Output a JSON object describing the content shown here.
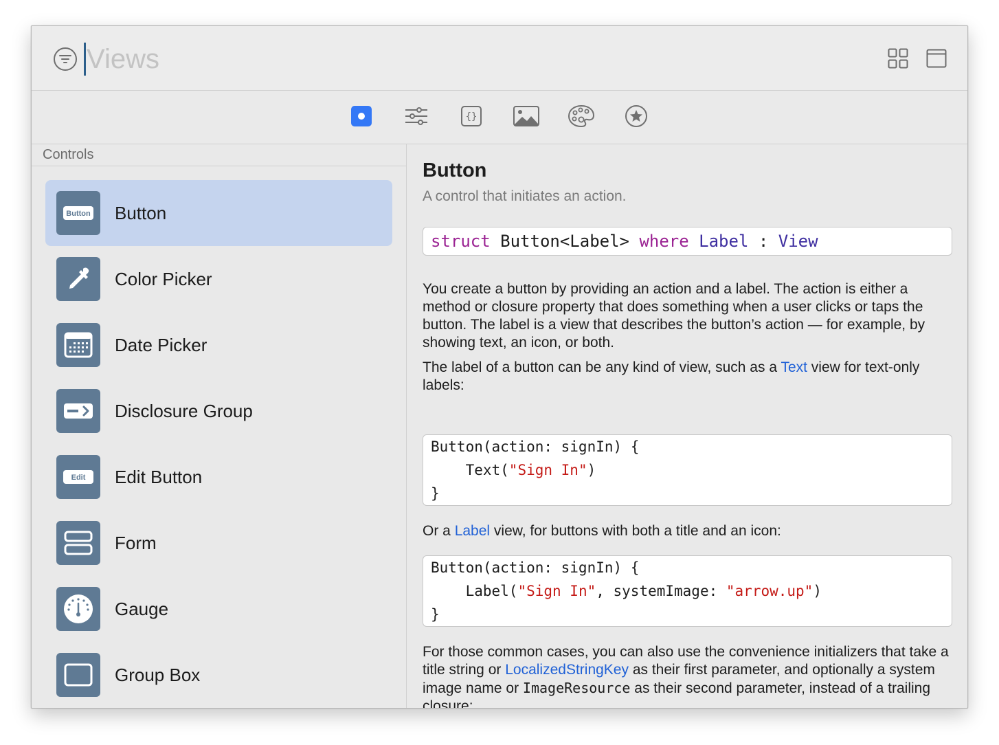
{
  "search": {
    "value": "Views"
  },
  "toolbar": {
    "tabs": [
      {
        "icon": "record-circle-icon",
        "selected": true
      },
      {
        "icon": "sliders-icon",
        "selected": false
      },
      {
        "icon": "braces-icon",
        "selected": false
      },
      {
        "icon": "photo-icon",
        "selected": false
      },
      {
        "icon": "palette-icon",
        "selected": false
      },
      {
        "icon": "star-circle-icon",
        "selected": false
      }
    ],
    "accent": "#3478f6"
  },
  "sidebar": {
    "section_title": "Controls",
    "items": [
      {
        "label": "Button",
        "icon": "button-icon",
        "icon_text": "Button",
        "selected": true
      },
      {
        "label": "Color Picker",
        "icon": "eyedropper-icon"
      },
      {
        "label": "Date Picker",
        "icon": "calendar-icon"
      },
      {
        "label": "Disclosure Group",
        "icon": "disclosure-icon"
      },
      {
        "label": "Edit Button",
        "icon": "edit-button-icon",
        "icon_text": "Edit"
      },
      {
        "label": "Form",
        "icon": "form-icon"
      },
      {
        "label": "Gauge",
        "icon": "gauge-icon"
      },
      {
        "label": "Group Box",
        "icon": "group-box-icon"
      }
    ]
  },
  "detail": {
    "title": "Button",
    "subtitle": "A control that initiates an action.",
    "declaration": {
      "kw_struct": "struct",
      "name": "Button<Label>",
      "kw_where": "where",
      "type_label": "Label",
      "colon": ":",
      "type_view": "View"
    },
    "para1": "You create a button by providing an action and a label. The action is either a method or closure property that does something when a user clicks or taps the button. The label is a view that describes the button’s action — for example, by showing text, an icon, or both.",
    "para2_pre": "The label of a button can be any kind of view, such as a ",
    "para2_link": "Text",
    "para2_post": " view for text-only labels:",
    "code1": {
      "line1": "Button(action: signIn) {",
      "line2_pre": "    Text(",
      "line2_str": "\"Sign In\"",
      "line2_post": ")",
      "line3": "}"
    },
    "para3_pre": "Or a ",
    "para3_link": "Label",
    "para3_post": " view, for buttons with both a title and an icon:",
    "code2": {
      "line1": "Button(action: signIn) {",
      "line2_pre": "    Label(",
      "line2_str1": "\"Sign In\"",
      "line2_mid": ", systemImage: ",
      "line2_str2": "\"arrow.up\"",
      "line2_post": ")",
      "line3": "}"
    },
    "para4_a": "For those common cases, you can also use the convenience initializers that take a title string or ",
    "para4_link": "LocalizedStringKey",
    "para4_b": " as their first parameter, and optionally a system image name or ",
    "para4_mono": "ImageResource",
    "para4_c": " as their second parameter, instead of a trailing closure:"
  }
}
